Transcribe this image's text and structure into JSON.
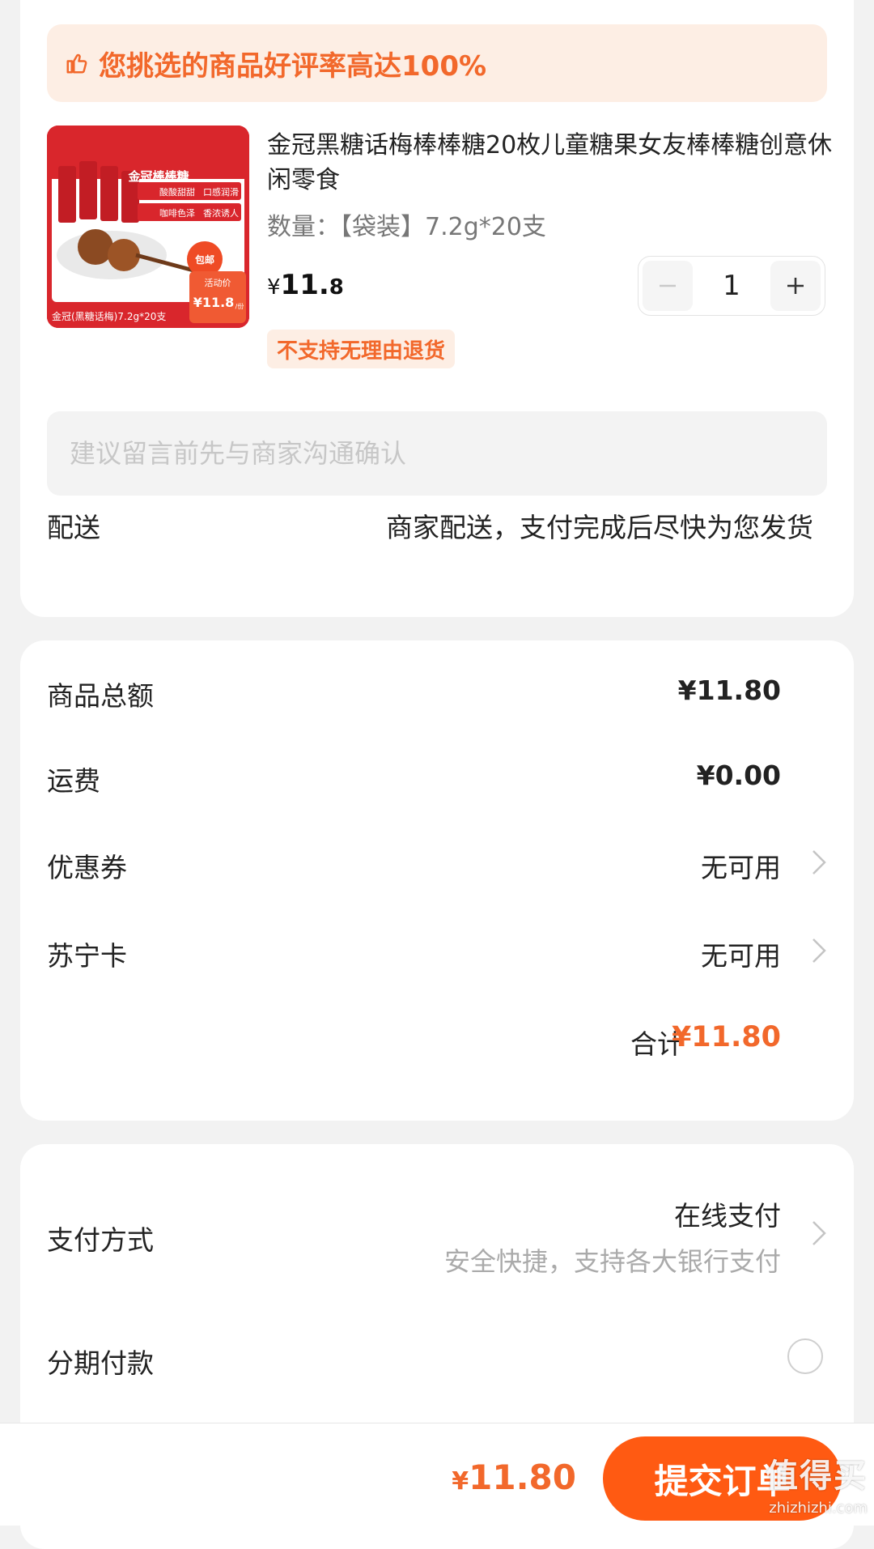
{
  "banner": {
    "text": "您挑选的商品好评率高达100%",
    "icon": "thumbs-up-icon"
  },
  "product": {
    "title": "金冠黑糖话梅棒棒糖20枚儿童糖果女友棒棒糖创意休闲零食",
    "spec": "数量：【袋装】7.2g*20支",
    "price": {
      "symbol": "¥",
      "integer": "11.",
      "decimal": "8"
    },
    "quantity": "1",
    "return_tag": "不支持无理由退货",
    "image": {
      "title": "金冠棒棒糖",
      "features": [
        "酸酸甜甜",
        "口感润滑",
        "咖啡色泽",
        "香浓诱人"
      ],
      "badge": "包邮",
      "caption": "金冠(黑糖话梅)7.2g*20支",
      "activity_label": "活动价",
      "activity_price": "¥11.8",
      "activity_unit": "/份"
    }
  },
  "message": {
    "placeholder": "建议留言前先与商家沟通确认"
  },
  "delivery": {
    "label": "配送",
    "value": "商家配送，支付完成后尽快为您发货"
  },
  "totals": {
    "goods_label": "商品总额",
    "goods_value": "¥11.80",
    "shipping_label": "运费",
    "shipping_value": "¥0.00",
    "coupon_label": "优惠券",
    "coupon_value": "无可用",
    "card_label": "苏宁卡",
    "card_value": "无可用",
    "sum_label": "合计",
    "sum_value": "¥11.80"
  },
  "payment": {
    "method_label": "支付方式",
    "method_value": "在线支付",
    "method_sub": "安全快捷，支持各大银行支付",
    "installment_label": "分期付款"
  },
  "bottom": {
    "symbol": "¥",
    "amount": "11.80",
    "submit_label": "提交订单"
  },
  "watermark": {
    "text": "值得买",
    "url": "zhizhizhi.com"
  },
  "colors": {
    "accent": "#f2682b",
    "button": "#ff5a12",
    "banner_bg": "#fdeee4"
  }
}
